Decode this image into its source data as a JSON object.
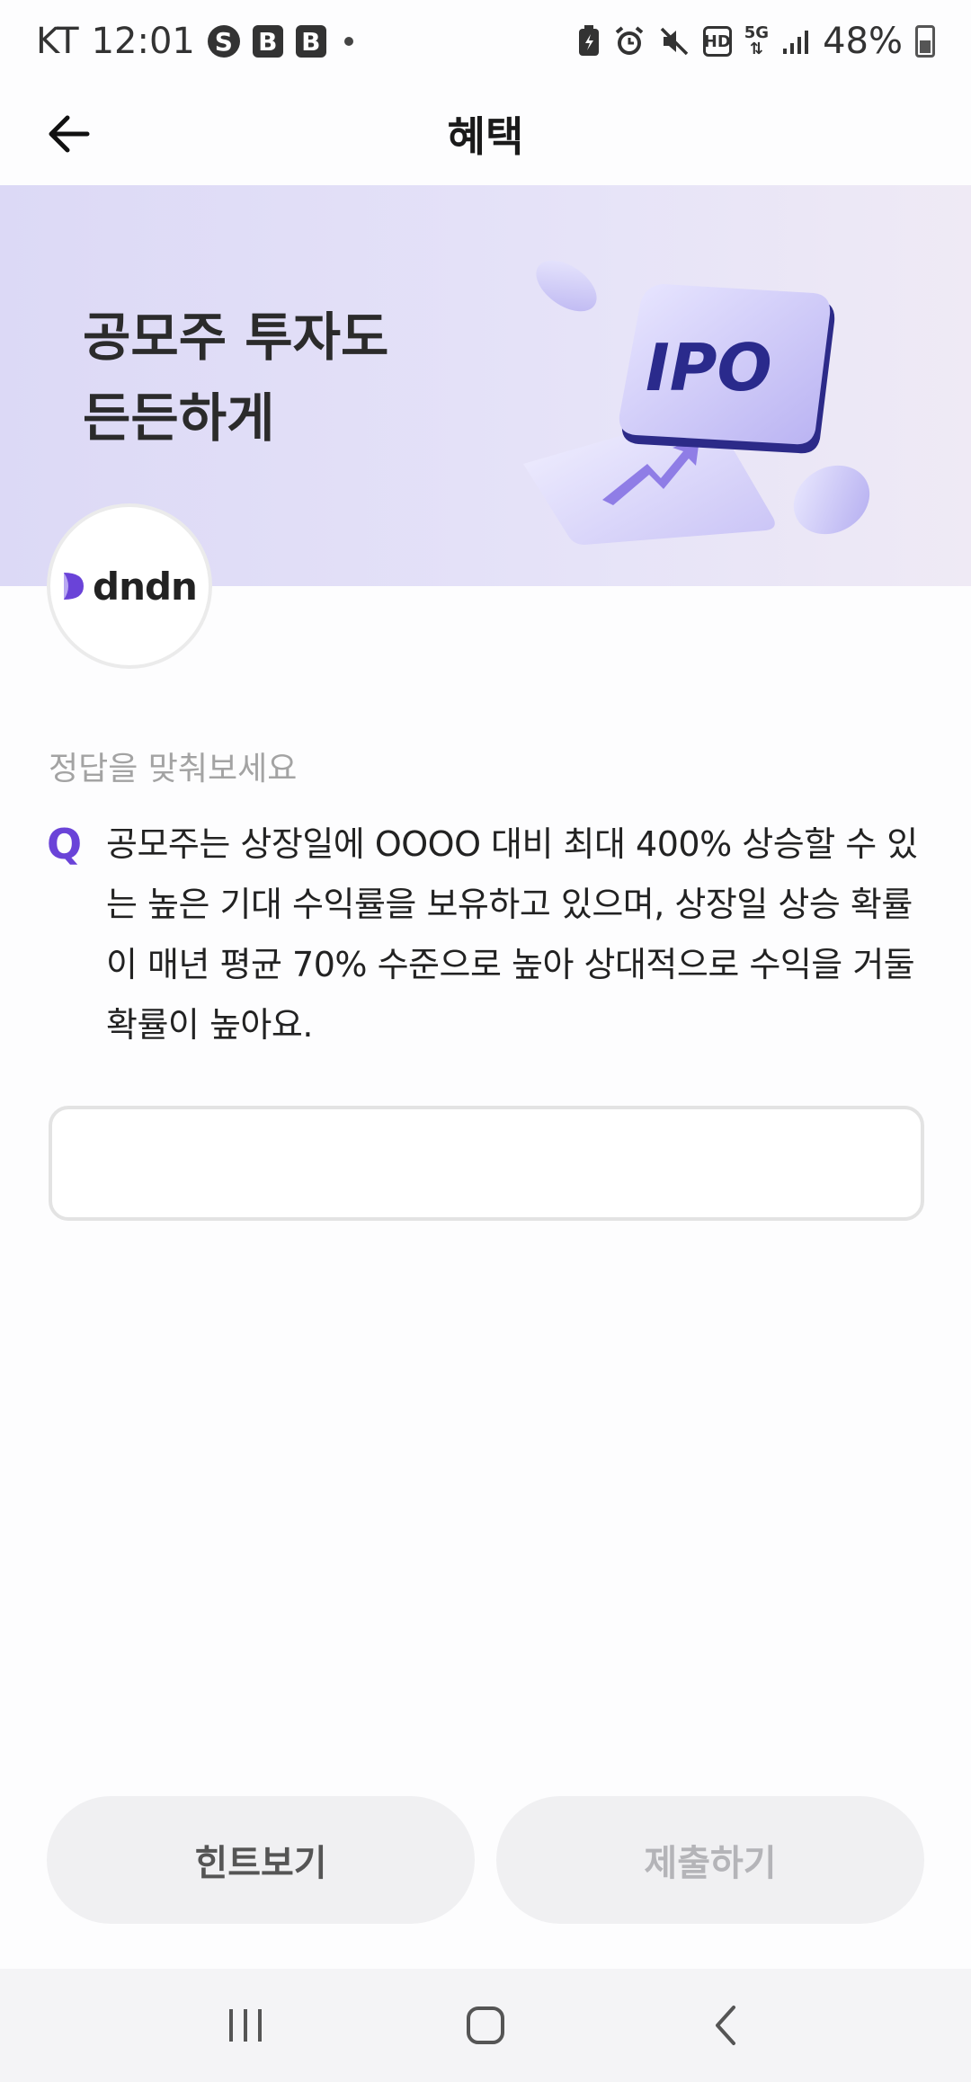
{
  "status_bar": {
    "carrier": "KT",
    "time": "12:01",
    "battery": "48%",
    "left_icons": [
      "s-circle-icon",
      "b-app-icon",
      "b-app-icon",
      "dot-icon"
    ],
    "right_icons": [
      "battery-saver-icon",
      "alarm-icon",
      "mute-icon",
      "hd-icon",
      "5g-icon",
      "signal-icon"
    ],
    "hd_label": "HD",
    "network_label": "5G"
  },
  "header": {
    "title": "혜택",
    "back_icon": "arrow-left-icon"
  },
  "banner": {
    "headline": "공모주 투자도\n든든하게",
    "art_label": "IPO",
    "background_color": "#dcd9f6"
  },
  "brand": {
    "name": "dndn",
    "accent_color": "#6a43d8"
  },
  "quiz": {
    "prompt": "정답을 맞춰보세요",
    "q_label": "Q",
    "question": "공모주는 상장일에 OOOO 대비 최대 400% 상승할 수 있는 높은 기대 수익률을 보유하고 있으며, 상장일 상승 확률이 매년 평균 70% 수준으로 높아 상대적으로 수익을 거둘 확률이 높아요.",
    "answer_value": "",
    "answer_placeholder": ""
  },
  "buttons": {
    "hint": "힌트보기",
    "submit": "제출하기"
  },
  "nav": {
    "recents_icon": "recents-icon",
    "home_icon": "home-icon",
    "back_icon": "chevron-left-icon"
  }
}
